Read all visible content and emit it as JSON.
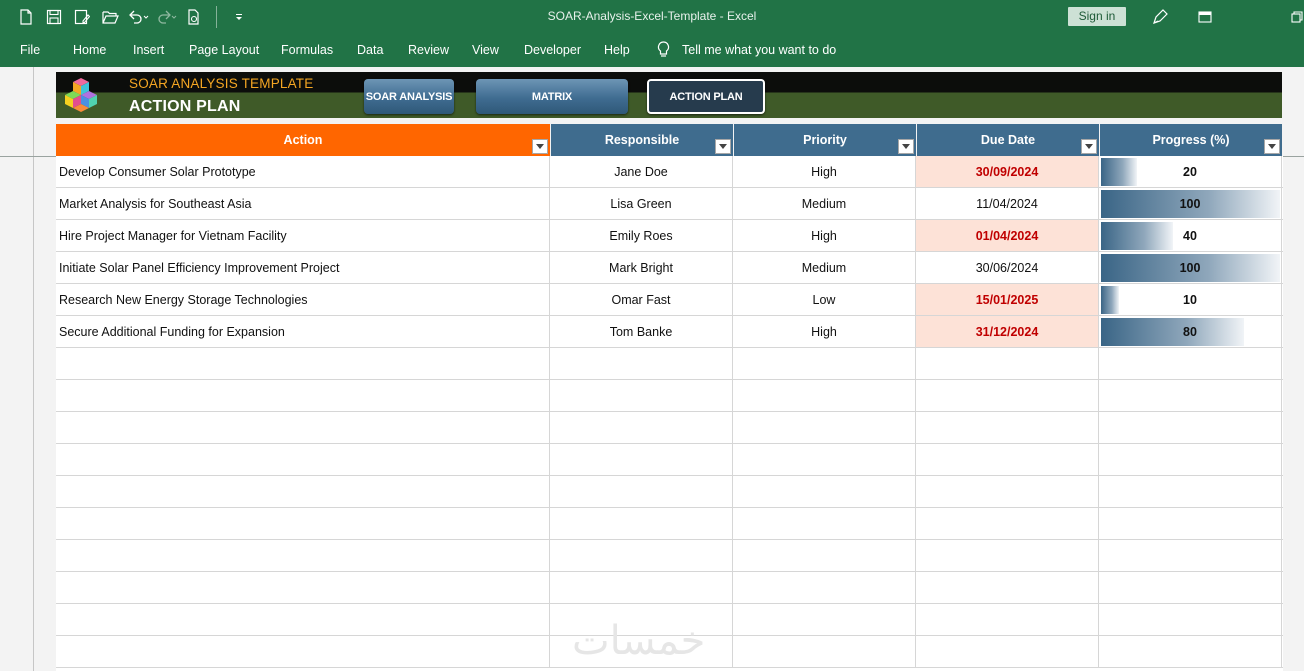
{
  "window": {
    "title": "SOAR-Analysis-Excel-Template  -  Excel",
    "sign_in": "Sign in"
  },
  "ribbon": {
    "tabs": [
      "File",
      "Home",
      "Insert",
      "Page Layout",
      "Formulas",
      "Data",
      "Review",
      "View",
      "Developer",
      "Help"
    ],
    "tell_me": "Tell me what you want to do"
  },
  "banner": {
    "subtitle": "SOAR ANALYSIS TEMPLATE",
    "title": "ACTION PLAN",
    "buttons": [
      "SOAR ANALYSIS",
      "MATRIX",
      "ACTION PLAN"
    ],
    "active_button": "ACTION PLAN"
  },
  "table": {
    "headers": [
      "Action",
      "Responsible",
      "Priority",
      "Due Date",
      "Progress (%)"
    ],
    "header_colors": {
      "action": "#ff6600",
      "other": "#3f6c8e"
    },
    "rows": [
      {
        "action": "Develop Consumer Solar Prototype",
        "responsible": "Jane Doe",
        "priority": "High",
        "due_date": "30/09/2024",
        "overdue": true,
        "progress": 20
      },
      {
        "action": "Market Analysis for Southeast Asia",
        "responsible": "Lisa Green",
        "priority": "Medium",
        "due_date": "11/04/2024",
        "overdue": false,
        "progress": 100
      },
      {
        "action": "Hire Project Manager for Vietnam Facility",
        "responsible": "Emily Roes",
        "priority": "High",
        "due_date": "01/04/2024",
        "overdue": true,
        "progress": 40
      },
      {
        "action": "Initiate Solar Panel Efficiency Improvement Project",
        "responsible": "Mark Bright",
        "priority": "Medium",
        "due_date": "30/06/2024",
        "overdue": false,
        "progress": 100
      },
      {
        "action": "Research New Energy Storage Technologies",
        "responsible": "Omar Fast",
        "priority": "Low",
        "due_date": "15/01/2025",
        "overdue": true,
        "progress": 10
      },
      {
        "action": "Secure Additional Funding for Expansion",
        "responsible": "Tom Banke",
        "priority": "High",
        "due_date": "31/12/2024",
        "overdue": true,
        "progress": 80
      }
    ]
  },
  "watermark": "خمسات",
  "colors": {
    "excel_green": "#217346",
    "overdue_bg": "#fde2d7",
    "overdue_text": "#c00000",
    "banner_subtitle": "#f5a623"
  }
}
